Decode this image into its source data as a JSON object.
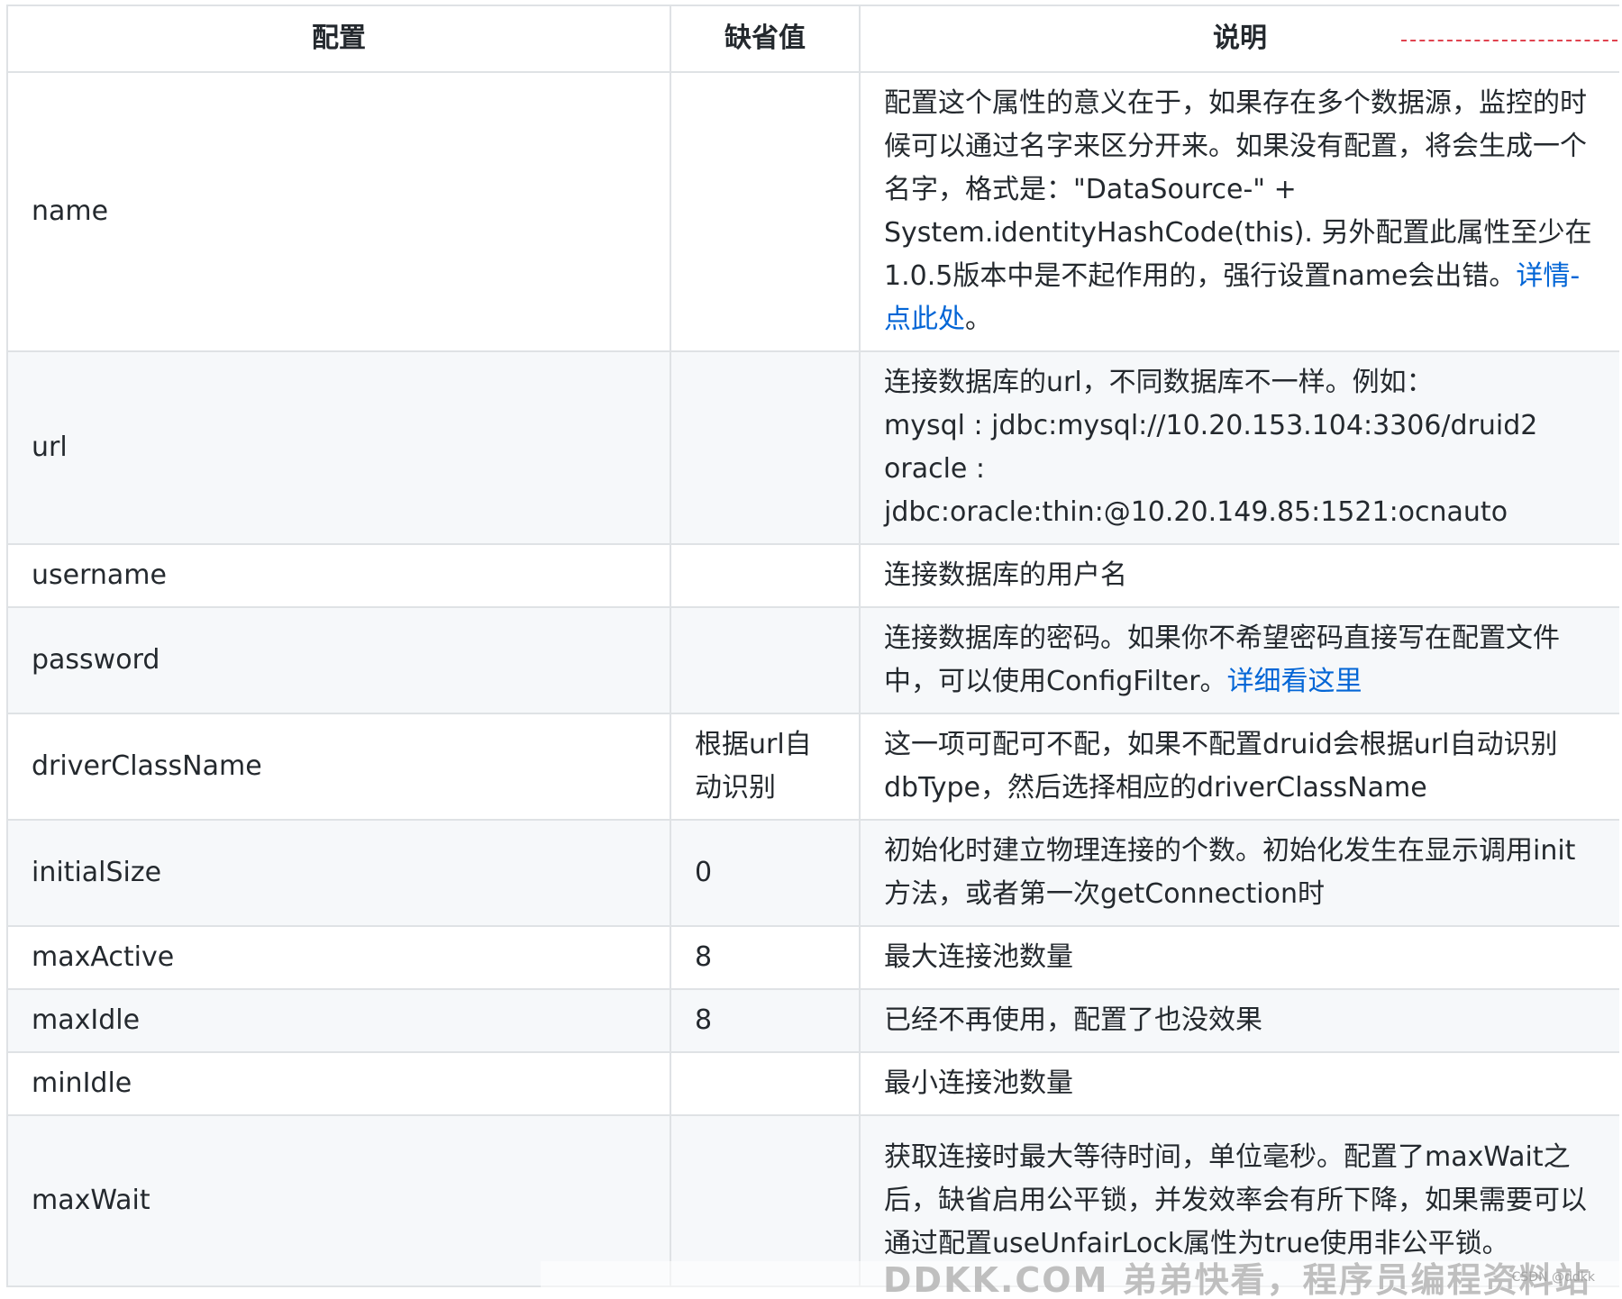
{
  "table": {
    "headers": [
      "配置",
      "缺省值",
      "说明"
    ],
    "rows": [
      {
        "name": "name",
        "default": "",
        "desc": "配置这个属性的意义在于，如果存在多个数据源，监控的时候可以通过名字来区分开来。如果没有配置，将会生成一个名字，格式是：\"DataSource-\" + System.identityHashCode(this). 另外配置此属性至少在1.0.5版本中是不起作用的，强行设置name会出错。",
        "link": "详情-点此处",
        "tail": "。"
      },
      {
        "name": "url",
        "default": "",
        "desc_lines": [
          "连接数据库的url，不同数据库不一样。例如：",
          "mysql : jdbc:mysql://10.20.153.104:3306/druid2",
          "oracle : jdbc:oracle:thin:@10.20.149.85:1521:ocnauto"
        ]
      },
      {
        "name": "username",
        "default": "",
        "desc": "连接数据库的用户名"
      },
      {
        "name": "password",
        "default": "",
        "desc": "连接数据库的密码。如果你不希望密码直接写在配置文件中，可以使用ConfigFilter。",
        "link": "详细看这里"
      },
      {
        "name": "driverClassName",
        "default": "根据url自动识别",
        "desc": "这一项可配可不配，如果不配置druid会根据url自动识别dbType，然后选择相应的driverClassName"
      },
      {
        "name": "initialSize",
        "default": "0",
        "desc": "初始化时建立物理连接的个数。初始化发生在显示调用init方法，或者第一次getConnection时"
      },
      {
        "name": "maxActive",
        "default": "8",
        "desc": "最大连接池数量"
      },
      {
        "name": "maxIdle",
        "default": "8",
        "desc": "已经不再使用，配置了也没效果"
      },
      {
        "name": "minIdle",
        "default": "",
        "desc": "最小连接池数量"
      },
      {
        "name": "maxWait",
        "default": "",
        "desc": "获取连接时最大等待时间，单位毫秒。配置了maxWait之后，缺省启用公平锁，并发效率会有所下降，如果需要可以通过配置useUnfairLock属性为true使用非公平锁。"
      }
    ]
  },
  "watermark": {
    "text": "DDKK.COM 弟弟快看，程序员编程资料站",
    "csdn": "CSDN @ddkk"
  }
}
